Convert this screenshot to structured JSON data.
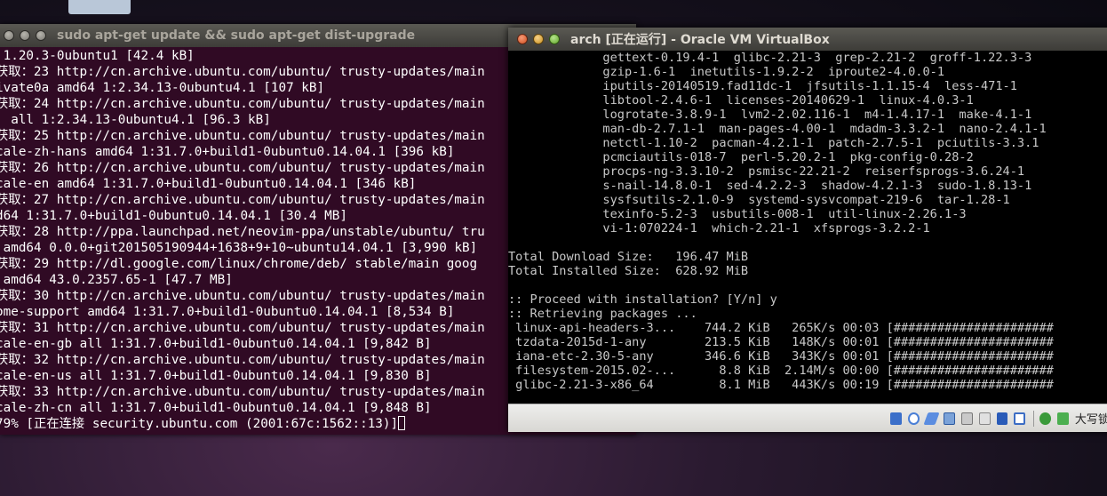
{
  "desktop": {
    "top_icon": "drive-icon"
  },
  "terminal": {
    "title": "sudo apt-get update && sudo apt-get dist-upgrade",
    "lines": [
      " 1.20.3-0ubuntu1 [42.4 kB]",
      "获取：23 http://cn.archive.ubuntu.com/ubuntu/ trusty-updates/main",
      "ivate0a amd64 1:2.34.13-0ubuntu4.1 [107 kB]",
      "获取：24 http://cn.archive.ubuntu.com/ubuntu/ trusty-updates/main",
      "  all 1:2.34.13-0ubuntu4.1 [96.3 kB]",
      "获取：25 http://cn.archive.ubuntu.com/ubuntu/ trusty-updates/main",
      "cale-zh-hans amd64 1:31.7.0+build1-0ubuntu0.14.04.1 [396 kB]",
      "获取：26 http://cn.archive.ubuntu.com/ubuntu/ trusty-updates/main",
      "cale-en amd64 1:31.7.0+build1-0ubuntu0.14.04.1 [346 kB]",
      "获取：27 http://cn.archive.ubuntu.com/ubuntu/ trusty-updates/main",
      "d64 1:31.7.0+build1-0ubuntu0.14.04.1 [30.4 MB]",
      "获取：28 http://ppa.launchpad.net/neovim-ppa/unstable/ubuntu/ tru",
      " amd64 0.0.0+git201505190944+1638+9+10~ubuntu14.04.1 [3,990 kB]",
      "获取：29 http://dl.google.com/linux/chrome/deb/ stable/main goog",
      " amd64 43.0.2357.65-1 [47.7 MB]",
      "获取：30 http://cn.archive.ubuntu.com/ubuntu/ trusty-updates/main",
      "ome-support amd64 1:31.7.0+build1-0ubuntu0.14.04.1 [8,534 B]",
      "获取：31 http://cn.archive.ubuntu.com/ubuntu/ trusty-updates/main",
      "cale-en-gb all 1:31.7.0+build1-0ubuntu0.14.04.1 [9,842 B]",
      "获取：32 http://cn.archive.ubuntu.com/ubuntu/ trusty-updates/main",
      "cale-en-us all 1:31.7.0+build1-0ubuntu0.14.04.1 [9,830 B]",
      "获取：33 http://cn.archive.ubuntu.com/ubuntu/ trusty-updates/main",
      "cale-zh-cn all 1:31.7.0+build1-0ubuntu0.14.04.1 [9,848 B]"
    ],
    "last_line": "79% [正在连接 security.ubuntu.com (2001:67c:1562::13)]"
  },
  "vbox": {
    "title": "arch [正在运行] - Oracle VM VirtualBox",
    "lines": [
      "             gettext-0.19.4-1  glibc-2.21-3  grep-2.21-2  groff-1.22.3-3",
      "             gzip-1.6-1  inetutils-1.9.2-2  iproute2-4.0.0-1",
      "             iputils-20140519.fad11dc-1  jfsutils-1.1.15-4  less-471-1",
      "             libtool-2.4.6-1  licenses-20140629-1  linux-4.0.3-1",
      "             logrotate-3.8.9-1  lvm2-2.02.116-1  m4-1.4.17-1  make-4.1-1",
      "             man-db-2.7.1-1  man-pages-4.00-1  mdadm-3.3.2-1  nano-2.4.1-1",
      "             netctl-1.10-2  pacman-4.2.1-1  patch-2.7.5-1  pciutils-3.3.1",
      "             pcmciautils-018-7  perl-5.20.2-1  pkg-config-0.28-2",
      "             procps-ng-3.3.10-2  psmisc-22.21-2  reiserfsprogs-3.6.24-1",
      "             s-nail-14.8.0-1  sed-4.2.2-3  shadow-4.2.1-3  sudo-1.8.13-1",
      "             sysfsutils-2.1.0-9  systemd-sysvcompat-219-6  tar-1.28-1",
      "             texinfo-5.2-3  usbutils-008-1  util-linux-2.26.1-3",
      "             vi-1:070224-1  which-2.21-1  xfsprogs-3.2.2-1",
      "",
      "Total Download Size:   196.47 MiB",
      "Total Installed Size:  628.92 MiB",
      "",
      ":: Proceed with installation? [Y/n] y",
      ":: Retrieving packages ...",
      " linux-api-headers-3...    744.2 KiB   265K/s 00:03 [######################",
      " tzdata-2015d-1-any        213.5 KiB   148K/s 00:01 [######################",
      " iana-etc-2.30-5-any       346.6 KiB   343K/s 00:01 [######################",
      " filesystem-2015.02-...      8.8 KiB  2.14M/s 00:00 [######################",
      " glibc-2.21-3-x86_64         8.1 MiB   443K/s 00:19 [######################",
      "_"
    ],
    "status_icons": [
      "optical-drive-icon",
      "cd-icon",
      "pen-icon",
      "network-icon",
      "folder-icon",
      "usb-icon",
      "display-icon",
      "capture-icon",
      "arrow-icon",
      "download-icon"
    ],
    "capslock_text": "大写锁定"
  }
}
